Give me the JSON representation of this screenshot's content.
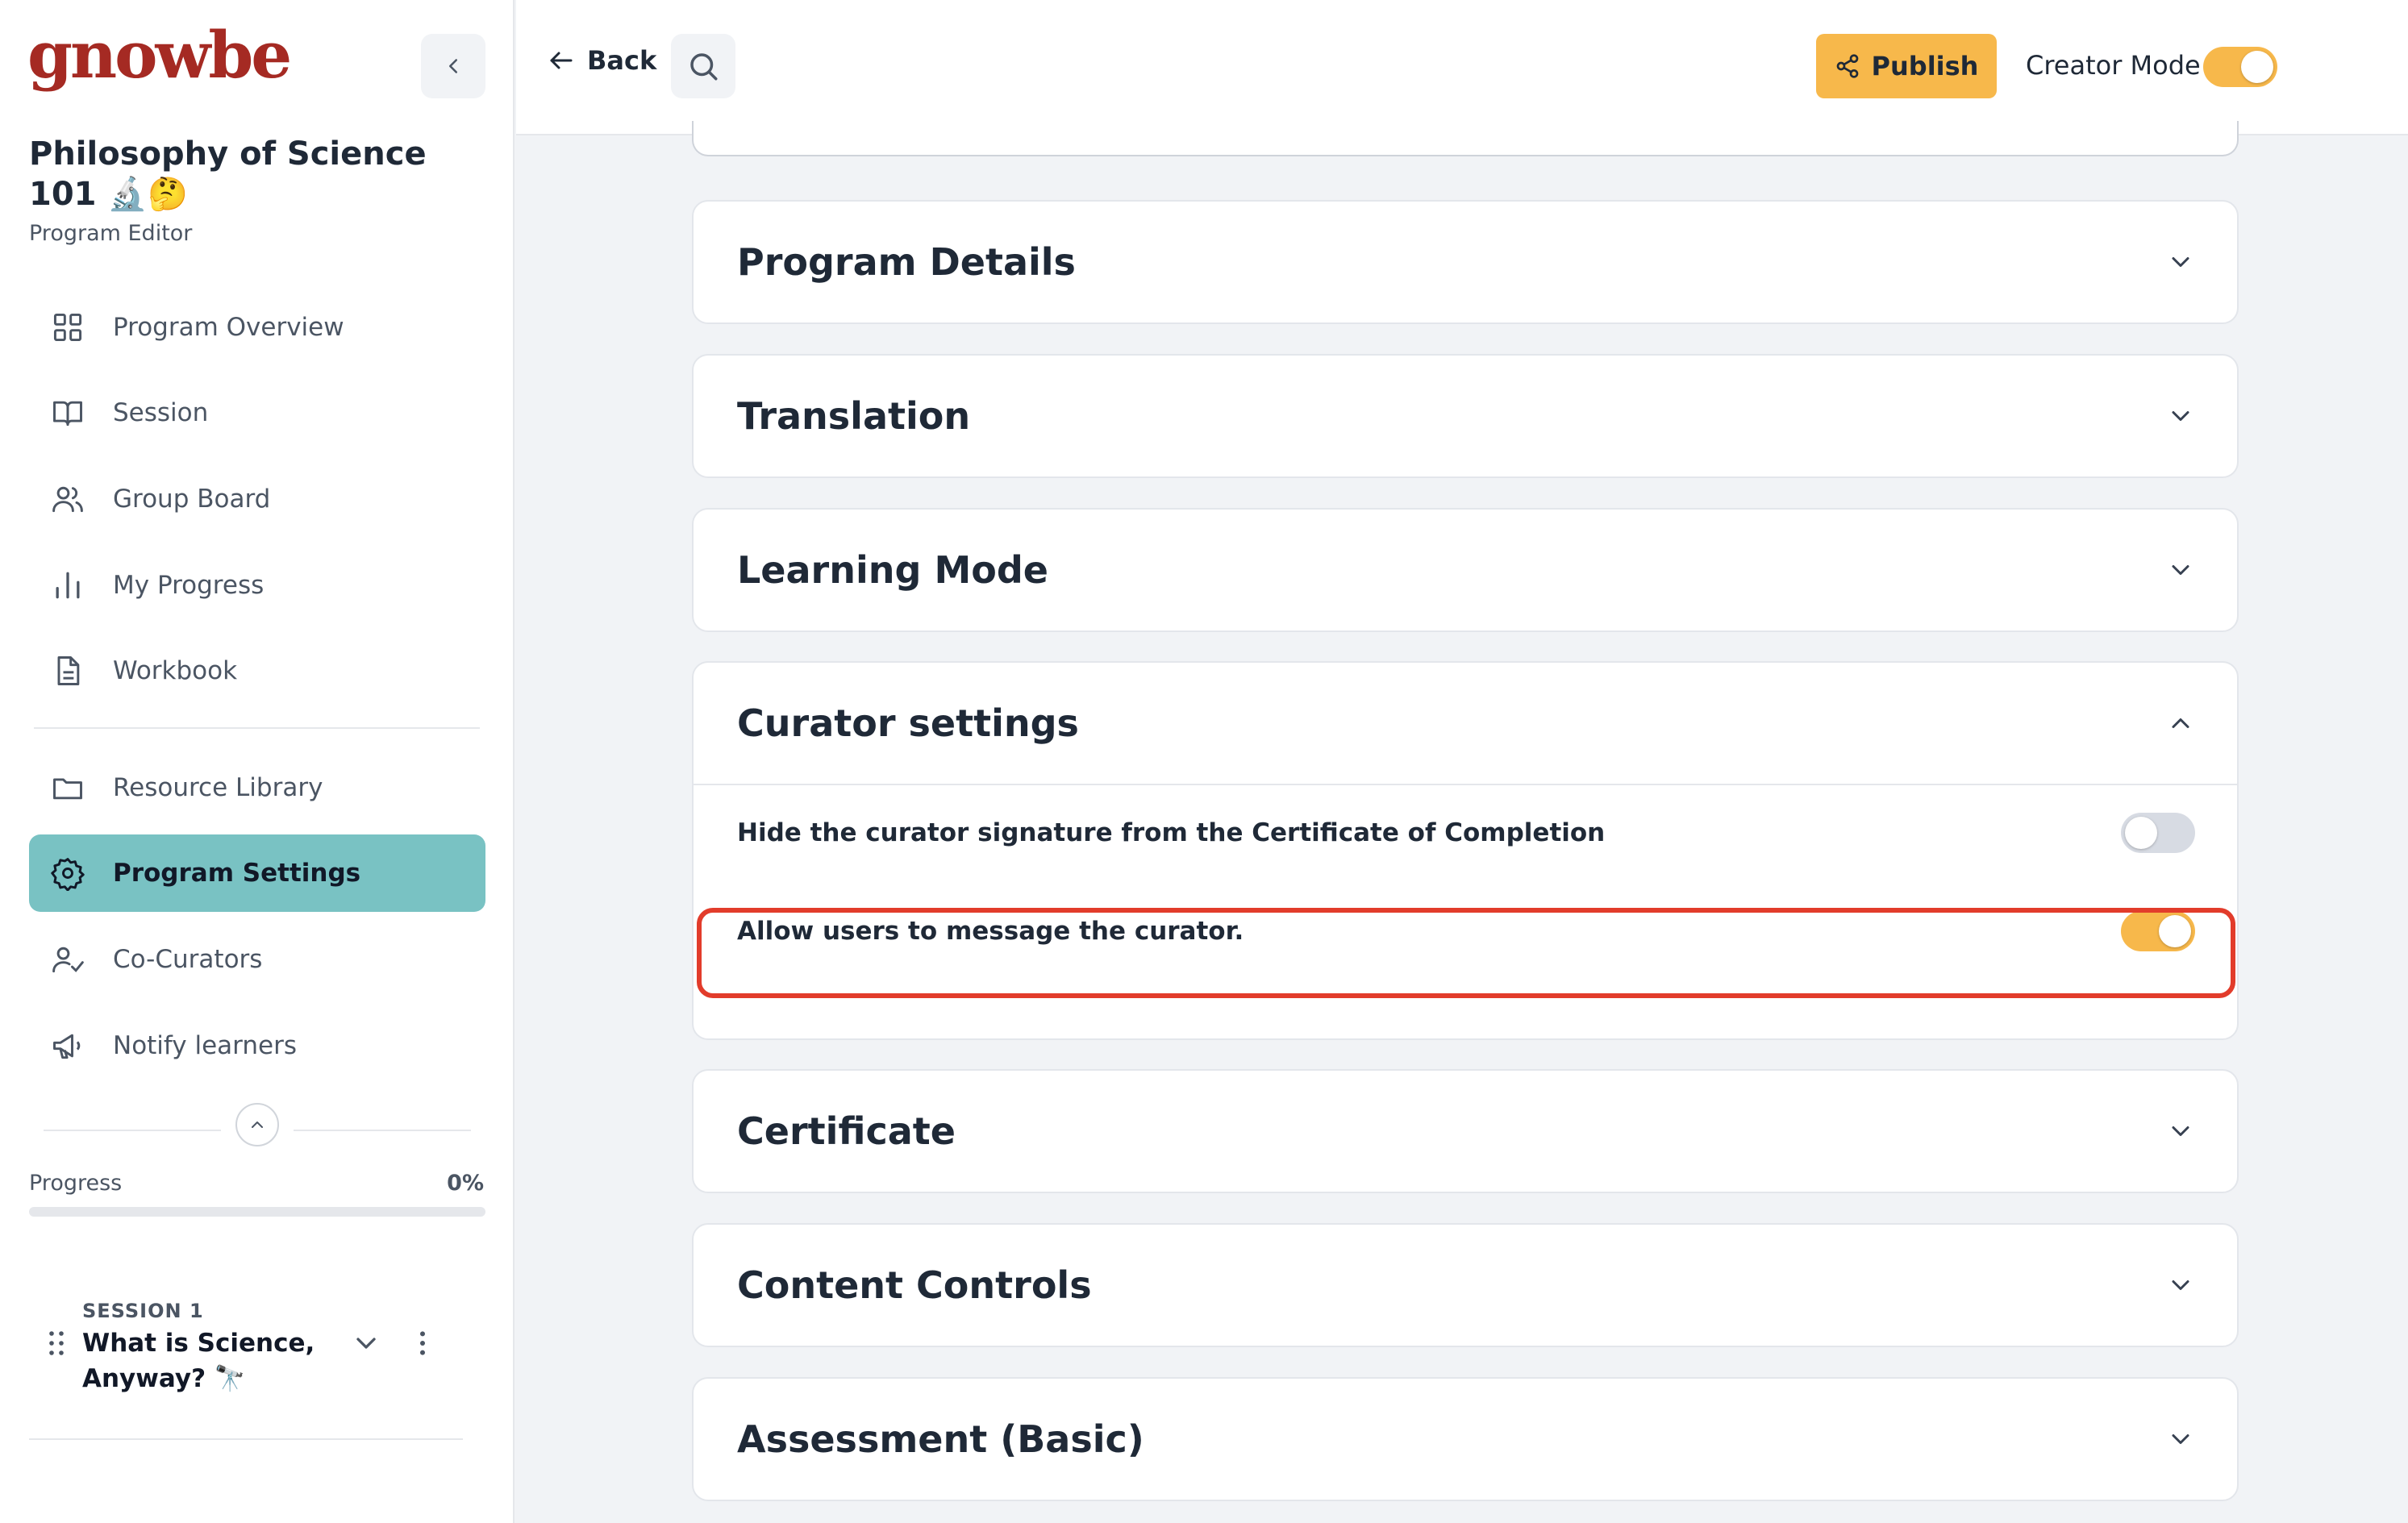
{
  "brand": {
    "logo_text": "gnowbe",
    "accent": "#a52a23",
    "teal": "#79c2c3",
    "yellow": "#f7b84b",
    "highlight": "#e23c2b"
  },
  "program": {
    "title": "Philosophy of Science 101 🔬🤔",
    "subtitle": "Program Editor"
  },
  "nav": {
    "items": [
      {
        "label": "Program Overview",
        "icon": "grid-icon"
      },
      {
        "label": "Session",
        "icon": "book-icon"
      },
      {
        "label": "Group Board",
        "icon": "users-icon"
      },
      {
        "label": "My Progress",
        "icon": "bar-chart-icon"
      },
      {
        "label": "Workbook",
        "icon": "document-icon"
      },
      {
        "label": "Resource Library",
        "icon": "folder-icon"
      },
      {
        "label": "Program Settings",
        "icon": "gear-icon",
        "active": true
      },
      {
        "label": "Co-Curators",
        "icon": "user-check-icon"
      },
      {
        "label": "Notify learners",
        "icon": "megaphone-icon"
      }
    ]
  },
  "progress": {
    "label": "Progress",
    "value_text": "0%",
    "value": 0
  },
  "session": {
    "kicker": "SESSION 1",
    "title": "What is Science, Anyway? 🔭"
  },
  "topbar": {
    "back_label": "Back",
    "publish_label": "Publish",
    "creator_mode_label": "Creator Mode",
    "creator_mode_on": true
  },
  "sections": [
    {
      "title": "Program Details",
      "expanded": false
    },
    {
      "title": "Translation",
      "expanded": false
    },
    {
      "title": "Learning Mode",
      "expanded": false
    },
    {
      "title": "Curator settings",
      "expanded": true,
      "settings": [
        {
          "label": "Hide the curator signature from the Certificate of Completion",
          "on": false
        },
        {
          "label": "Allow users to message the curator.",
          "on": true,
          "highlighted": true
        }
      ]
    },
    {
      "title": "Certificate",
      "expanded": false
    },
    {
      "title": "Content Controls",
      "expanded": false
    },
    {
      "title": "Assessment (Basic)",
      "expanded": false
    }
  ]
}
